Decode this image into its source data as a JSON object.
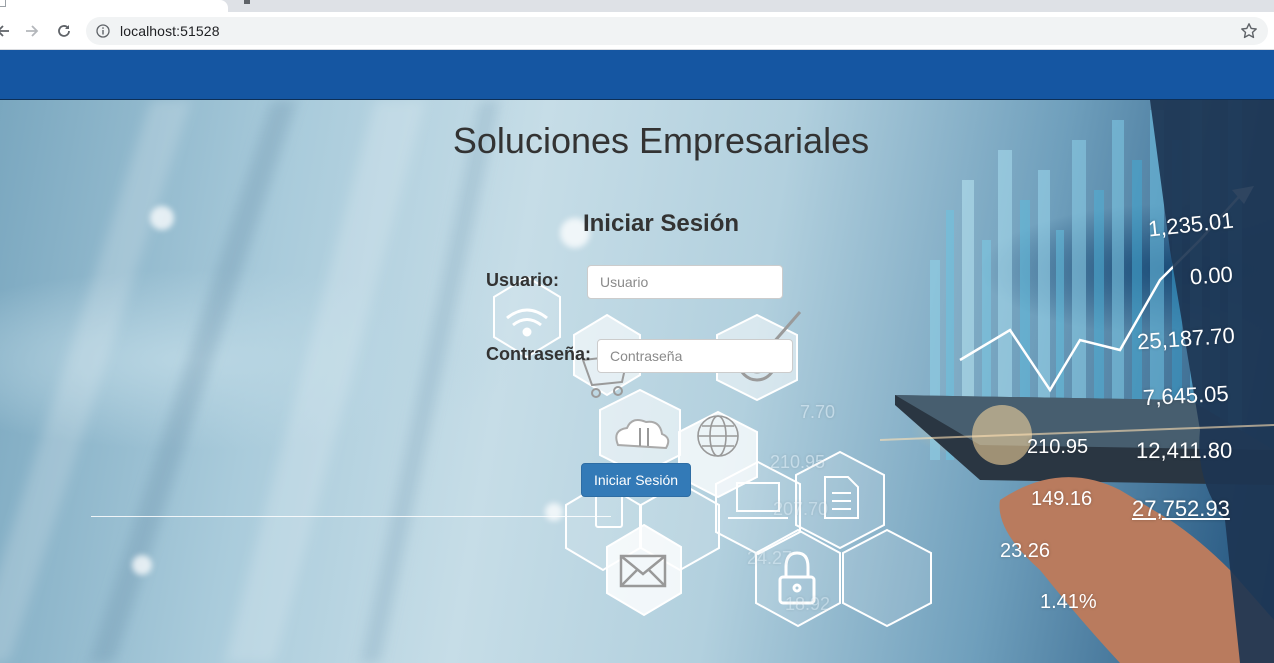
{
  "browser": {
    "url": "localhost:51528",
    "icons": {
      "back": "back-arrow-icon",
      "forward": "forward-arrow-icon",
      "reload": "reload-icon",
      "info": "info-icon",
      "bookmark": "star-icon"
    }
  },
  "page": {
    "navbar_color": "#1556a2",
    "title": "Soluciones Empresariales",
    "login": {
      "heading": "Iniciar Sesión",
      "user_label": "Usuario:",
      "user_placeholder": "Usuario",
      "password_label": "Contraseña:",
      "password_placeholder": "Contraseña",
      "submit_label": "Iniciar Sesión",
      "button_color": "#337ab7"
    }
  },
  "background_figures": {
    "right_column": [
      "1,235.01",
      "0.00",
      "25,187.70",
      "7,645.05",
      "12,411.80",
      "27,752.93"
    ],
    "center_column": [
      "210.95",
      "149.16",
      "23.26",
      "1.41%"
    ],
    "faint": [
      "7.70",
      "210.95",
      "207.70",
      "24.27",
      "18.92"
    ]
  }
}
